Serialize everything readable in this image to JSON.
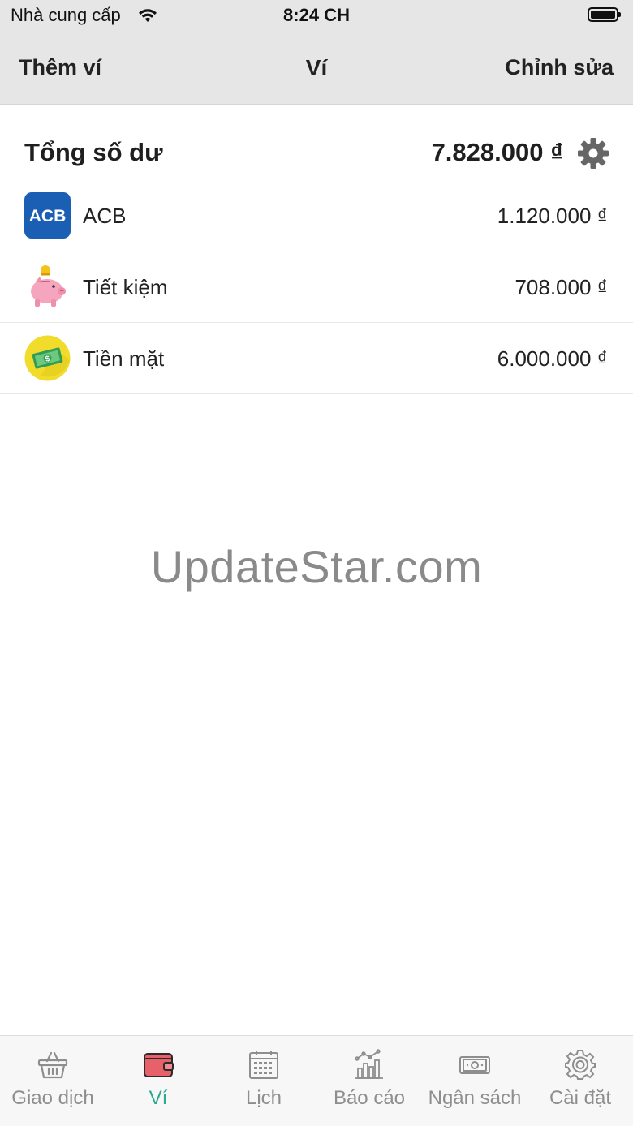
{
  "status_bar": {
    "carrier": "Nhà cung cấp",
    "time": "8:24 CH"
  },
  "nav": {
    "left": "Thêm ví",
    "title": "Ví",
    "right": "Chỉnh sửa"
  },
  "total": {
    "label": "Tổng số dư",
    "amount": "7.828.000 ₫"
  },
  "wallets": [
    {
      "name": "ACB",
      "amount": "1.120.000 ₫",
      "icon": "acb-logo-icon",
      "icon_text": "ACB"
    },
    {
      "name": "Tiết kiệm",
      "amount": "708.000 ₫",
      "icon": "piggy-bank-icon"
    },
    {
      "name": "Tiền mặt",
      "amount": "6.000.000 ₫",
      "icon": "cash-icon"
    }
  ],
  "watermark": "UpdateStar.com",
  "tabs": [
    {
      "label": "Giao dịch",
      "icon": "basket-icon",
      "active": false
    },
    {
      "label": "Ví",
      "icon": "wallet-icon",
      "active": true
    },
    {
      "label": "Lịch",
      "icon": "calendar-icon",
      "active": false
    },
    {
      "label": "Báo cáo",
      "icon": "report-chart-icon",
      "active": false
    },
    {
      "label": "Ngân sách",
      "icon": "budget-money-icon",
      "active": false
    },
    {
      "label": "Cài đặt",
      "icon": "gear-icon",
      "active": false
    }
  ],
  "colors": {
    "accent": "#2aab91",
    "header_bg": "#e6e6e6",
    "tab_inactive": "#8e8e8e",
    "acb_blue": "#1b5fb4",
    "wallet_red": "#e8606a"
  }
}
